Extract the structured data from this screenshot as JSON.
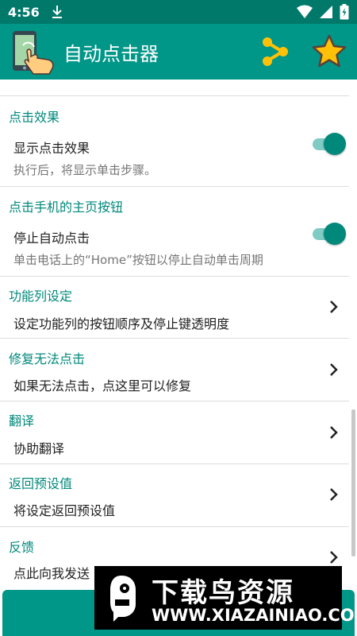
{
  "status_bar": {
    "time": "4:56"
  },
  "app_bar": {
    "title": "自动点击器"
  },
  "sections": [
    {
      "category": "点击效果",
      "title": "显示点击效果",
      "summary": "执行后，将显示单击步骤。",
      "toggle_on": true
    },
    {
      "category": "点击手机的主页按钮",
      "title": "停止自动点击",
      "summary": "单击电话上的“Home”按钮以停止自动单击周期",
      "toggle_on": true
    },
    {
      "category": "功能列设定",
      "title": "设定功能列的按钮顺序及停止键透明度"
    },
    {
      "category": "修复无法点击",
      "title": "如果无法点击，点这里可以修复"
    },
    {
      "category": "翻译",
      "title": "协助翻译"
    },
    {
      "category": "返回预设值",
      "title": "将设定返回预设值"
    },
    {
      "category": "反馈",
      "title": "点此向我发送"
    }
  ],
  "watermark": {
    "text": "下载鸟资源",
    "url": "WWW.XIAZAINIAO.COM"
  },
  "colors": {
    "primary": "#009688",
    "status_bar": "#00796b",
    "accent": "#00897b",
    "toggle_track": "#80cbc4",
    "star": "#ffc107"
  },
  "icons": [
    "download-icon",
    "wifi-icon",
    "signal-icon",
    "battery-icon",
    "share-icon",
    "star-icon",
    "chevron-right-icon",
    "hand-phone-app-icon"
  ]
}
